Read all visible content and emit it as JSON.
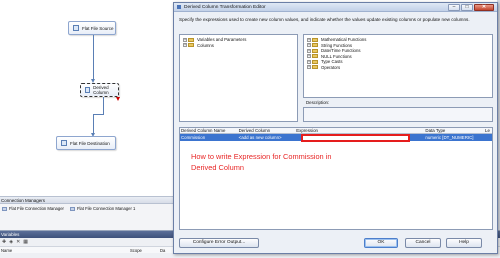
{
  "designer": {
    "source_label": "Flat File Source",
    "derived_label": "Derived Column",
    "destination_label": "Flat File Destination"
  },
  "connection_managers": {
    "header": "Connection Managers",
    "items": [
      "Flat File Connection Manager",
      "Flat File Connection Manager 1"
    ]
  },
  "variables": {
    "header": "Variables",
    "columns": [
      "Name",
      "Scope",
      "Da"
    ]
  },
  "dialog": {
    "title": "Derived Column Transformation Editor",
    "description": "Specify the expressions used to create new column values, and indicate whether the values update existing columns or populate new columns.",
    "left_tree": [
      {
        "label": "Variables and Parameters",
        "icon": "folder-icon"
      },
      {
        "label": "Columns",
        "icon": "folder-icon"
      }
    ],
    "right_tree": [
      {
        "label": "Mathematical Functions",
        "icon": "folder-icon"
      },
      {
        "label": "String Functions",
        "icon": "folder-icon"
      },
      {
        "label": "Date/Time Functions",
        "icon": "folder-icon"
      },
      {
        "label": "NULL Functions",
        "icon": "folder-icon"
      },
      {
        "label": "Type Casts",
        "icon": "folder-icon"
      },
      {
        "label": "Operators",
        "icon": "folder-icon"
      }
    ],
    "description_label": "Description:",
    "grid": {
      "headers": [
        "Derived Column Name",
        "Derived Column",
        "Expression",
        "Data Type",
        "Le"
      ],
      "rows": [
        {
          "name": "Commission",
          "derived": "<add as new column>",
          "expression": "",
          "data_type": "numeric [DT_NUMERIC]"
        }
      ]
    },
    "annotation": "How to write Expression for Commission in Derived Column",
    "buttons": {
      "configure": "Configure Error Output...",
      "ok": "OK",
      "cancel": "Cancel",
      "help": "Help"
    },
    "colors": {
      "highlight": "#e51d1d",
      "selection": "#3b74cf"
    }
  }
}
